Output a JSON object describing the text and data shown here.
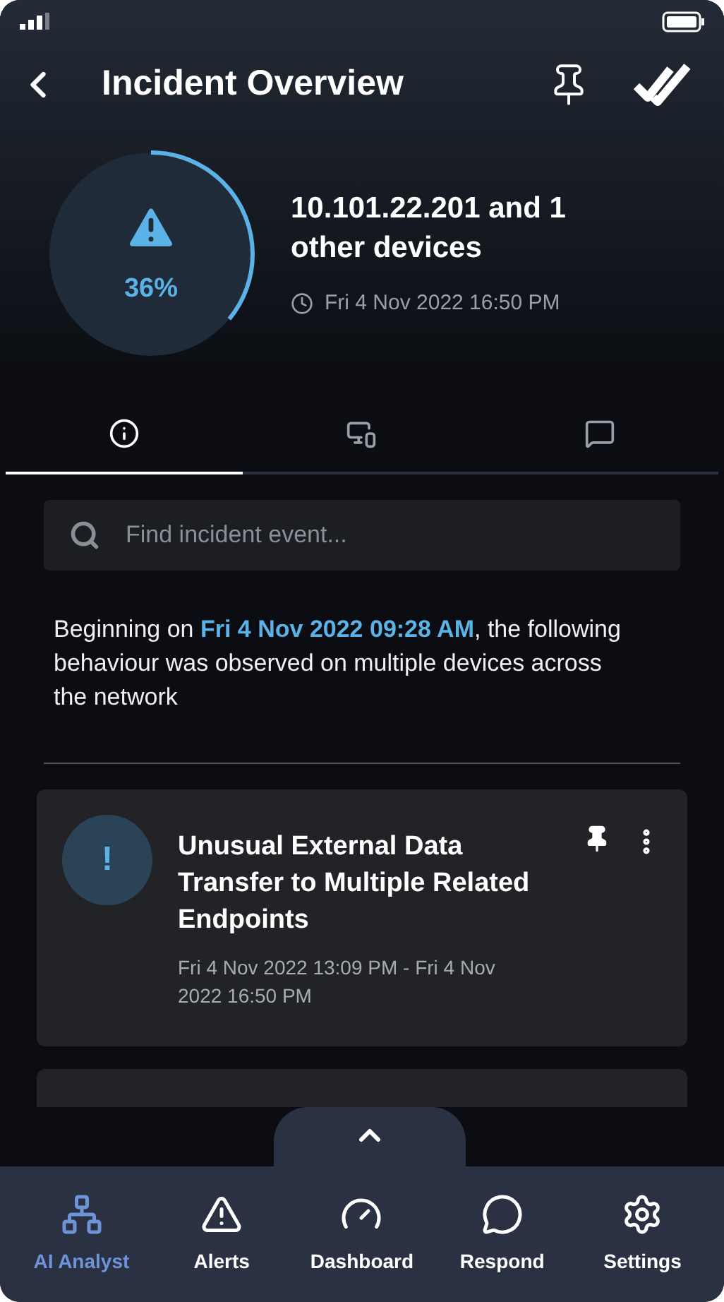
{
  "header": {
    "title": "Incident Overview"
  },
  "summary": {
    "level": 0.36,
    "percent": "36%",
    "title": "10.101.22.201 and 1 other devices",
    "time": "Fri 4 Nov 2022 16:50 PM"
  },
  "tabs": [
    {
      "kind": "info",
      "selected": true
    },
    {
      "kind": "devices",
      "selected": false
    },
    {
      "kind": "comments",
      "selected": false
    }
  ],
  "search": {
    "placeholder": "Find incident event..."
  },
  "description": {
    "before": "Beginning on ",
    "highlight": "Fri 4 Nov 2022 09:28 AM",
    "after": ", the following behaviour was observed on multiple devices across the network"
  },
  "events": [
    {
      "icon": "!",
      "title": "Unusual External Data Transfer to Multiple Related Endpoints",
      "time": "Fri 4 Nov 2022 13:09 PM - Fri 4 Nov 2022 16:50 PM"
    },
    {
      "kind": "clipped"
    }
  ],
  "nav": [
    {
      "kind": "analyst",
      "label": "AI Analyst",
      "selected": true
    },
    {
      "kind": "alerts",
      "label": "Alerts",
      "selected": false
    },
    {
      "kind": "dashboard",
      "label": "Dashboard",
      "selected": false
    },
    {
      "kind": "respond",
      "label": "Respond",
      "selected": false
    },
    {
      "kind": "settings",
      "label": "Settings",
      "selected": false
    }
  ]
}
